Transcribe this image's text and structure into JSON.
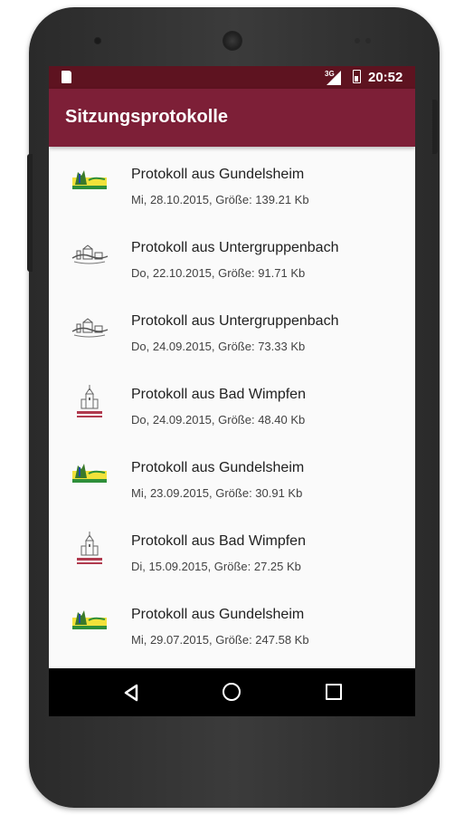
{
  "status_bar": {
    "time": "20:52",
    "network": "3G"
  },
  "app_bar": {
    "title": "Sitzungsprotokolle"
  },
  "items": [
    {
      "title": "Protokoll aus Gundelsheim",
      "subtitle": "Mi, 28.10.2015, Größe: 139.21 Kb",
      "logo": "gundelsheim"
    },
    {
      "title": "Protokoll aus Untergruppenbach",
      "subtitle": "Do, 22.10.2015, Größe: 91.71 Kb",
      "logo": "untergruppenbach"
    },
    {
      "title": "Protokoll aus Untergruppenbach",
      "subtitle": "Do, 24.09.2015, Größe: 73.33 Kb",
      "logo": "untergruppenbach"
    },
    {
      "title": "Protokoll aus Bad Wimpfen",
      "subtitle": "Do, 24.09.2015, Größe: 48.40 Kb",
      "logo": "bad-wimpfen"
    },
    {
      "title": "Protokoll aus Gundelsheim",
      "subtitle": "Mi, 23.09.2015, Größe: 30.91 Kb",
      "logo": "gundelsheim"
    },
    {
      "title": "Protokoll aus Bad Wimpfen",
      "subtitle": "Di, 15.09.2015, Größe: 27.25 Kb",
      "logo": "bad-wimpfen"
    },
    {
      "title": "Protokoll aus Gundelsheim",
      "subtitle": "Mi, 29.07.2015, Größe: 247.58 Kb",
      "logo": "gundelsheim"
    }
  ],
  "colors": {
    "app_bar": "#7d1f37",
    "status_bar": "#5e1320",
    "nav_bar": "#000000",
    "background": "#fafafa"
  },
  "icons": {
    "nav_back": "back-triangle",
    "nav_home": "home-circle",
    "nav_recent": "recent-square"
  }
}
